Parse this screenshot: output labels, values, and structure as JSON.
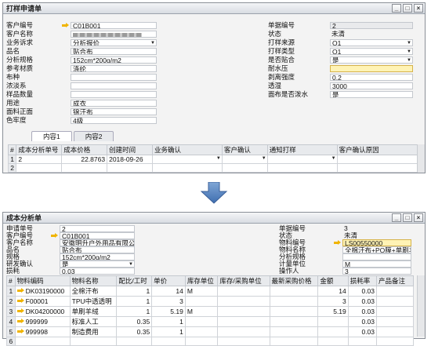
{
  "win1": {
    "title": "打样申请单",
    "controls": [
      "_",
      "□",
      "×"
    ],
    "left_fields": [
      {
        "label": "客户编号",
        "value": "C01B001",
        "link": true
      },
      {
        "label": "客户名称",
        "value": "",
        "blurred": true
      },
      {
        "label": "业务诉求",
        "value": "分析报价",
        "dropdown": true
      },
      {
        "label": "品名",
        "value": "贴合布"
      },
      {
        "label": "分析规格",
        "value": "152cm*200g/m2"
      },
      {
        "label": "参考材质",
        "value": "涤纶"
      },
      {
        "label": "布种",
        "value": ""
      },
      {
        "label": "浓淡系",
        "value": ""
      },
      {
        "label": "样品数量",
        "value": ""
      },
      {
        "label": "用途",
        "value": "成衣"
      },
      {
        "label": "面料正面",
        "value": "锦汗布"
      },
      {
        "label": "色牢度",
        "value": "4级"
      }
    ],
    "right_fields": [
      {
        "label": "单据编号",
        "value": "2",
        "style": "gray"
      },
      {
        "label": "状态",
        "value": "未清",
        "style": "plain"
      },
      {
        "label": "打样来源",
        "value": "O1",
        "dropdown": true
      },
      {
        "label": "打样类型",
        "value": "O1",
        "dropdown": true
      },
      {
        "label": "是否贴合",
        "value": "是",
        "dropdown": true
      },
      {
        "label": "耐水压",
        "value": "",
        "style": "yellow"
      },
      {
        "label": "剥离强度",
        "value": "0.2"
      },
      {
        "label": "透湿",
        "value": "3000"
      },
      {
        "label": "面布是否泼水",
        "value": "是"
      }
    ],
    "tabs": [
      "内容1",
      "内容2"
    ],
    "grid": {
      "headers": [
        "#",
        "成本分析单号",
        "成本价格",
        "创建时间",
        "业务确认",
        "客户确认",
        "通知打样",
        "客户确认原因"
      ],
      "rows": [
        [
          "1",
          "2",
          "22.8763",
          "2018-09-26",
          "",
          "",
          "",
          ""
        ],
        [
          "2",
          "",
          "",
          "",
          "",
          "",
          "",
          ""
        ]
      ]
    }
  },
  "win2": {
    "title": "成本分析单",
    "controls": [
      "_",
      "□",
      "×"
    ],
    "left_fields": [
      {
        "label": "申请单号",
        "value": "2"
      },
      {
        "label": "客户编号",
        "value": "C01B001",
        "link": true
      },
      {
        "label": "客户名称",
        "value": "安徽明升户外用品有限公司"
      },
      {
        "label": "品名",
        "value": "贴合布"
      },
      {
        "label": "规格",
        "value": "152cm*200g/m2"
      },
      {
        "label": "研发确认",
        "value": "是",
        "dropdown": true
      },
      {
        "label": "损耗",
        "value": "0.03"
      }
    ],
    "right_fields": [
      {
        "label": "单据编号",
        "value": "3",
        "style": "plain"
      },
      {
        "label": "状态",
        "value": "未清",
        "style": "plain"
      },
      {
        "label": "物料编号",
        "value": "LS00550000",
        "style": "yellow",
        "link": true
      },
      {
        "label": "物料名称",
        "value": "全棉汗布+PO膜+单刷羊绒"
      },
      {
        "label": "分析规格",
        "value": ""
      },
      {
        "label": "计量单位",
        "value": "M"
      },
      {
        "label": "操作人",
        "value": "3"
      }
    ],
    "grid": {
      "headers": [
        "#",
        "物料编码",
        "物料名称",
        "配比/工时",
        "单价",
        "库存单位",
        "库存/采购单位",
        "最新采购价格",
        "金额",
        "损耗率",
        "产品备注"
      ],
      "rows": [
        [
          "1",
          "DK03190000",
          "全棉汗布",
          "1",
          "14",
          "M",
          "",
          "",
          "14",
          "0.03",
          ""
        ],
        [
          "2",
          "F00001",
          "TPU中透透明",
          "1",
          "3",
          "",
          "",
          "",
          "3",
          "0.03",
          ""
        ],
        [
          "3",
          "DK04200000",
          "单刷羊绒",
          "1",
          "5.19",
          "M",
          "",
          "",
          "5.19",
          "0.03",
          ""
        ],
        [
          "4",
          "999999",
          "标准人工",
          "0.35",
          "1",
          "",
          "",
          "",
          "",
          "0.03",
          ""
        ],
        [
          "5",
          "999998",
          "制造费用",
          "0.35",
          "1",
          "",
          "",
          "",
          "",
          "0.03",
          ""
        ],
        [
          "6",
          "",
          "",
          "",
          "",
          "",
          "",
          "",
          "",
          "",
          ""
        ]
      ]
    }
  }
}
